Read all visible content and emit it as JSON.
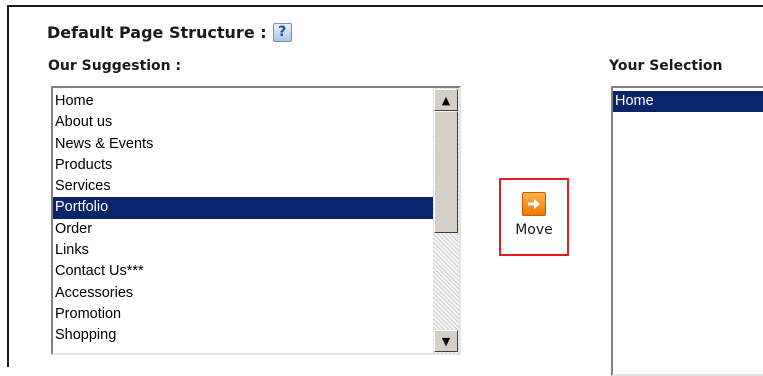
{
  "header": {
    "title": "Default Page Structure :",
    "help_label": "?"
  },
  "suggestion": {
    "label": "Our Suggestion :",
    "items": [
      {
        "label": "Home"
      },
      {
        "label": "About us"
      },
      {
        "label": "News & Events"
      },
      {
        "label": "Products"
      },
      {
        "label": "Services"
      },
      {
        "label": "Portfolio",
        "selected": true
      },
      {
        "label": "Order"
      },
      {
        "label": "Links"
      },
      {
        "label": "Contact Us***"
      },
      {
        "label": "Accessories"
      },
      {
        "label": "Promotion"
      },
      {
        "label": "Shopping"
      }
    ]
  },
  "move": {
    "label": "Move",
    "icon": "arrow-right-icon"
  },
  "selection": {
    "label": "Your Selection",
    "items": [
      {
        "label": "Home",
        "selected": true
      }
    ]
  },
  "colors": {
    "selected_bg": "#0a246a",
    "move_border": "#e31d1d",
    "move_icon": "#f07800"
  }
}
